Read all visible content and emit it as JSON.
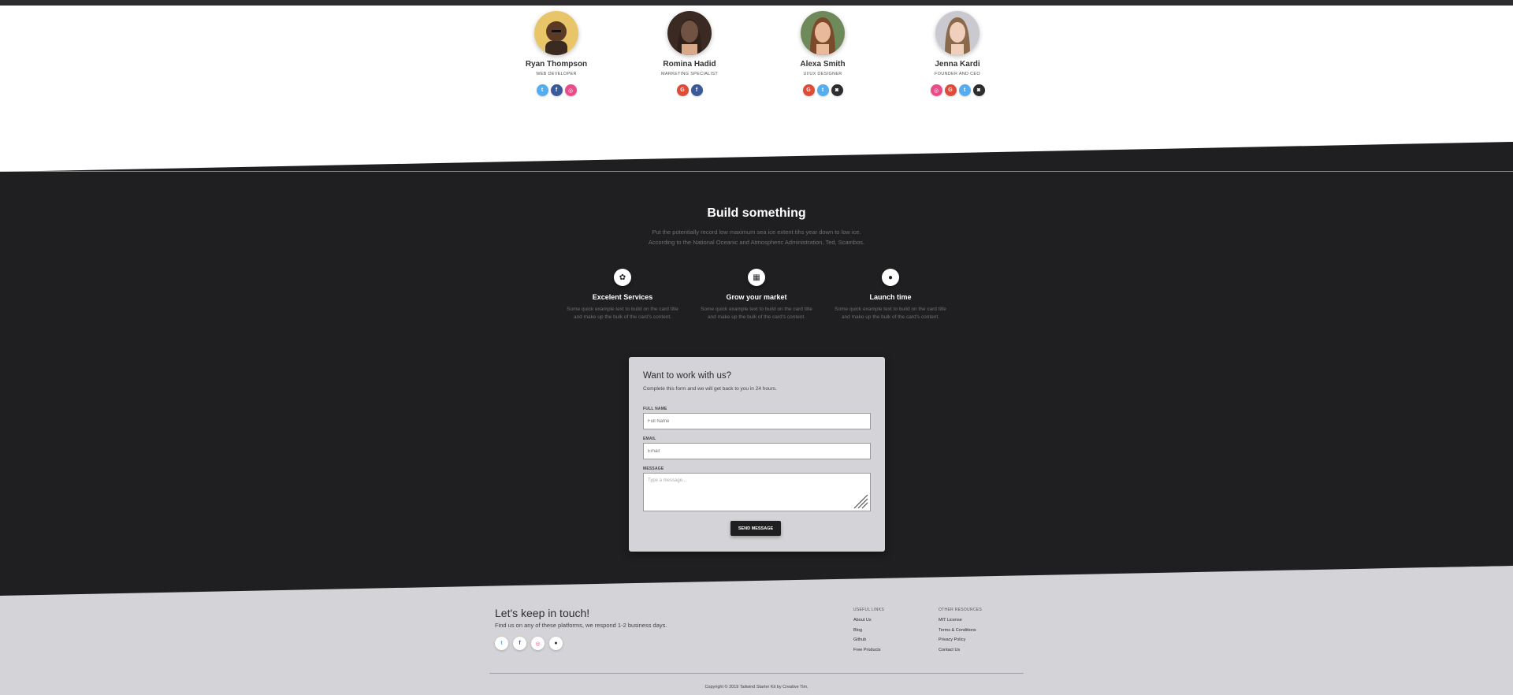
{
  "team": {
    "members": [
      {
        "name": "Ryan Thompson",
        "role": "WEB DEVELOPER",
        "socials": [
          "twitter-icon",
          "facebook-icon",
          "dribbble-icon"
        ]
      },
      {
        "name": "Romina Hadid",
        "role": "MARKETING SPECIALIST",
        "socials": [
          "google-icon",
          "facebook-icon"
        ]
      },
      {
        "name": "Alexa Smith",
        "role": "UI/UX DESIGNER",
        "socials": [
          "google-icon",
          "twitter-icon",
          "instagram-icon"
        ]
      },
      {
        "name": "Jenna Kardi",
        "role": "FOUNDER AND CEO",
        "socials": [
          "dribbble-icon",
          "google-icon",
          "twitter-icon",
          "instagram-icon"
        ]
      }
    ]
  },
  "build": {
    "title": "Build something",
    "subtitle_line1": "Put the potentially record low maximum sea ice extent tihs year down to low ice.",
    "subtitle_line2": "According to the National Oceanic and Atmospheric Administration, Ted, Scambos.",
    "features": [
      {
        "icon": "medal-icon",
        "title": "Excelent Services",
        "text_line1": "Some quick example text to build on the card title",
        "text_line2": "and make up the bulk of the card's content."
      },
      {
        "icon": "chart-icon",
        "title": "Grow your market",
        "text_line1": "Some quick example text to build on the card title",
        "text_line2": "and make up the bulk of the card's content."
      },
      {
        "icon": "lightbulb-icon",
        "title": "Launch time",
        "text_line1": "Some quick example text to build on the card title",
        "text_line2": "and make up the bulk of the card's content."
      }
    ]
  },
  "form": {
    "title": "Want to work with us?",
    "subtitle": "Complete this form and we will get back to you in 24 hours.",
    "fullname_label": "FULL NAME",
    "fullname_placeholder": "Full Name",
    "email_label": "EMAIL",
    "email_placeholder": "Email",
    "message_label": "MESSAGE",
    "message_placeholder": "Type a message...",
    "send_label": "SEND MESSAGE"
  },
  "footer": {
    "title": "Let's keep in touch!",
    "subtitle": "Find us on any of these platforms, we respond 1-2 business days.",
    "socials": [
      "twitter-icon",
      "facebook-icon",
      "dribbble-icon",
      "github-icon"
    ],
    "useful_links_title": "USEFUL LINKS",
    "useful_links": [
      "About Us",
      "Blog",
      "Github",
      "Free Products"
    ],
    "other_resources_title": "OTHER RESOURCES",
    "other_resources": [
      "MIT License",
      "Terms & Conditions",
      "Privacy Policy",
      "Contact Us"
    ],
    "copyright": "Copyright © 2019 Tailwind Starter Kit by Creative Tim."
  },
  "colors": {
    "dark": "#1f1f21",
    "light_gray": "#d4d4d8",
    "twitter": "#55acee",
    "facebook": "#3b5998",
    "dribbble": "#ea4c89",
    "google": "#dd4b39",
    "instagram": "#2d2d30"
  }
}
